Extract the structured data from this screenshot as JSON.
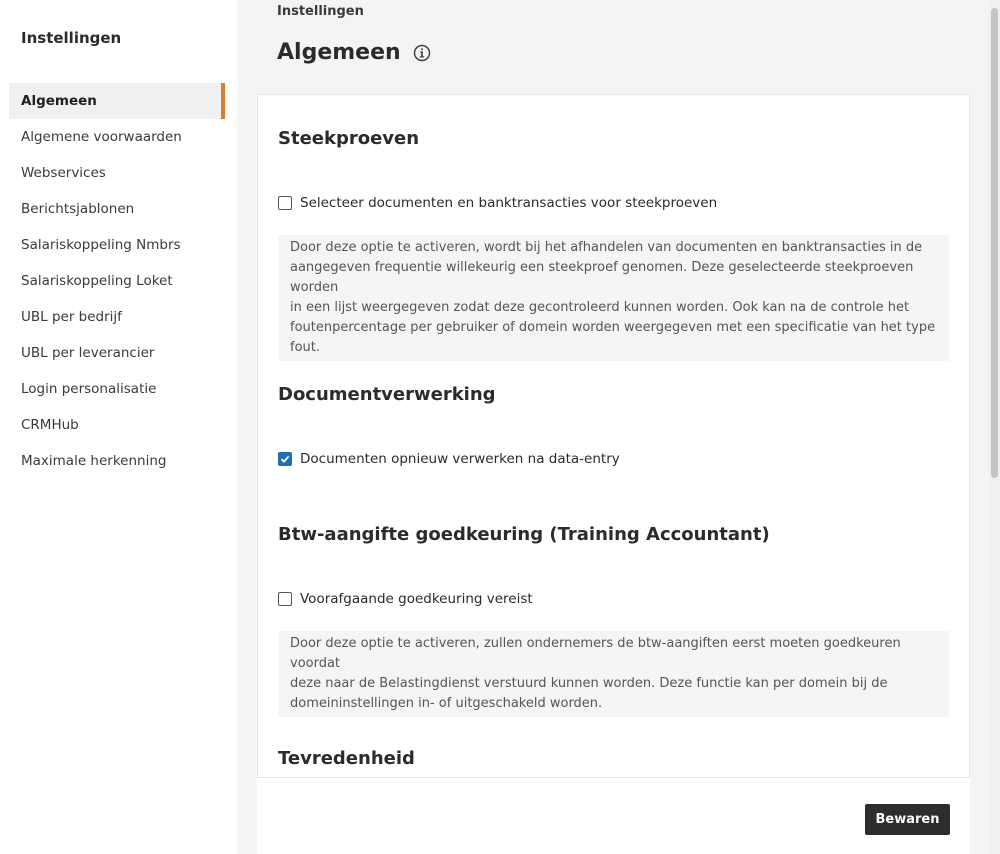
{
  "sidebar": {
    "title": "Instellingen",
    "items": [
      {
        "label": "Algemeen",
        "active": true
      },
      {
        "label": "Algemene voorwaarden"
      },
      {
        "label": "Webservices"
      },
      {
        "label": "Berichtsjablonen"
      },
      {
        "label": "Salariskoppeling Nmbrs"
      },
      {
        "label": "Salariskoppeling Loket"
      },
      {
        "label": "UBL per bedrijf"
      },
      {
        "label": "UBL per leverancier"
      },
      {
        "label": "Login personalisatie"
      },
      {
        "label": "CRMHub"
      },
      {
        "label": "Maximale herkenning"
      }
    ]
  },
  "header": {
    "breadcrumb": "Instellingen",
    "title": "Algemeen",
    "icon": "info-icon"
  },
  "sections": {
    "steekproeven": {
      "title": "Steekproeven",
      "checkbox_label": "Selecteer documenten en banktransacties voor steekproeven",
      "checked": false,
      "description": [
        "Door deze optie te activeren, wordt bij het afhandelen van documenten en banktransacties in de",
        "aangegeven frequentie willekeurig een steekproef genomen. Deze geselecteerde steekproeven worden",
        "in een lijst weergegeven zodat deze gecontroleerd kunnen worden. Ook kan na de controle het",
        "foutenpercentage per gebruiker of domein worden weergegeven met een specificatie van het type fout."
      ]
    },
    "documentverwerking": {
      "title": "Documentverwerking",
      "checkbox_label": "Documenten opnieuw verwerken na data-entry",
      "checked": true
    },
    "btw": {
      "title": "Btw-aangifte goedkeuring (Training Accountant)",
      "checkbox_label": "Voorafgaande goedkeuring vereist",
      "checked": false,
      "description": [
        "Door deze optie te activeren, zullen ondernemers de btw-aangiften eerst moeten goedkeuren voordat",
        "deze naar de Belastingdienst verstuurd kunnen worden. Deze functie kan per domein bij de",
        "domeininstellingen in- of uitgeschakeld worden."
      ]
    },
    "tevredenheid": {
      "title": "Tevredenheid"
    }
  },
  "footer": {
    "save_label": "Bewaren"
  },
  "colors": {
    "accent": "#e07a2e",
    "checkbox_checked": "#1f6fb2",
    "button_bg": "#2d2d2d"
  }
}
